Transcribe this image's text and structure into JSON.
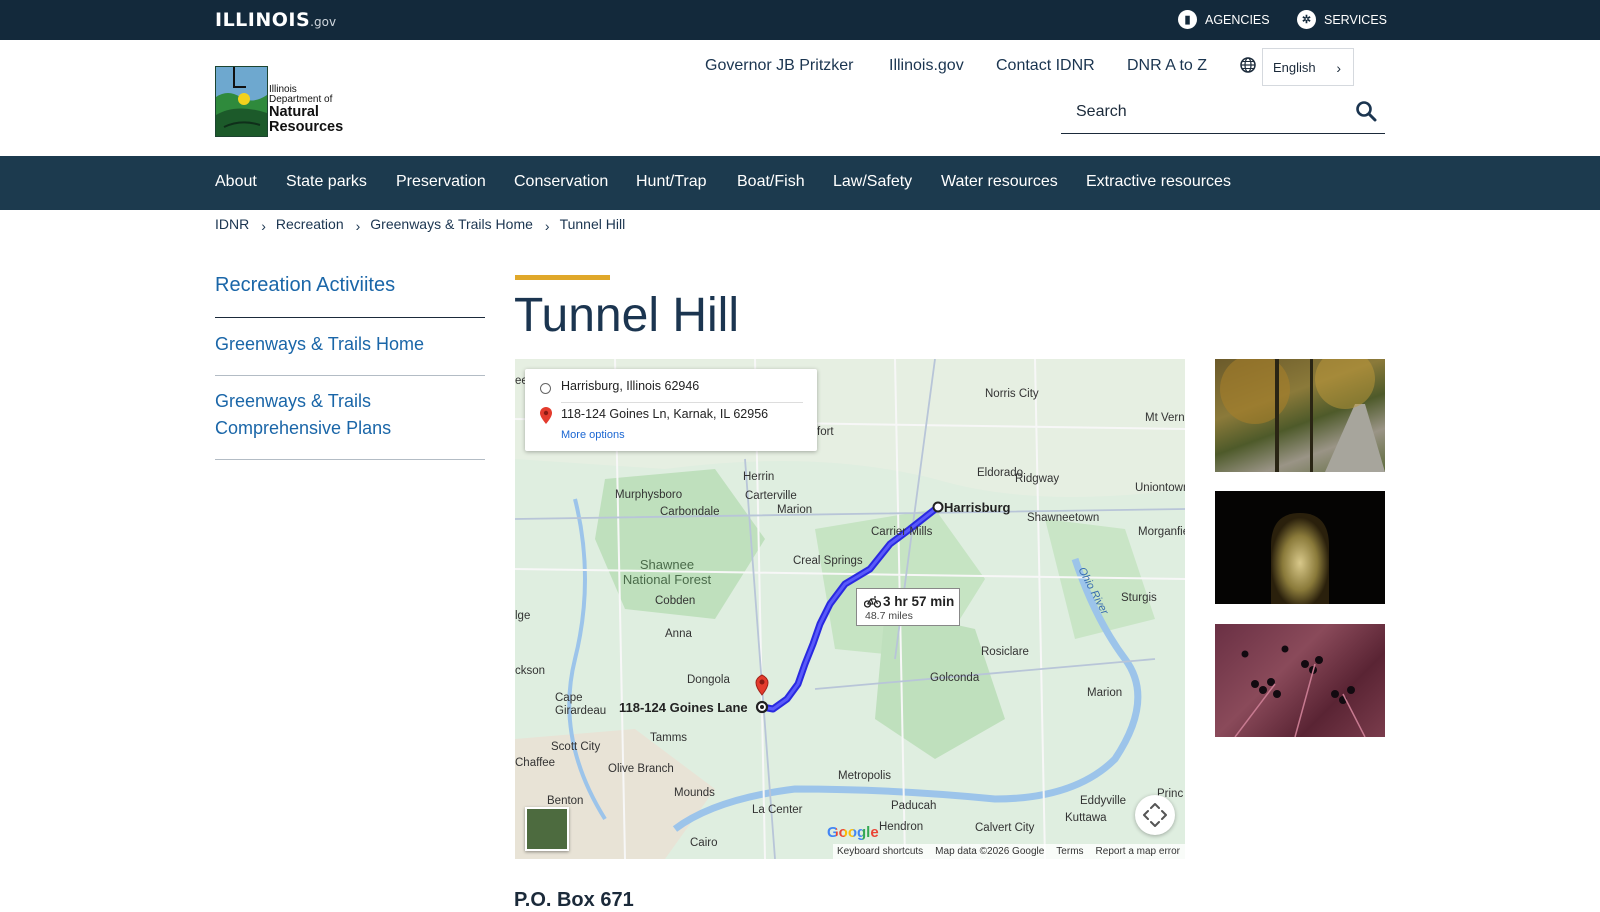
{
  "topbar": {
    "logo_main": "ILLINOIS",
    "logo_suffix": ".gov",
    "agencies": "AGENCIES",
    "services": "SERVICES"
  },
  "logo": {
    "line1": "Illinois",
    "line2": "Department of",
    "line3": "Natural",
    "line4": "Resources"
  },
  "utility_links": [
    "Governor JB Pritzker",
    "Illinois.gov",
    "Contact IDNR",
    "DNR A to Z"
  ],
  "language": {
    "selected": "English"
  },
  "search": {
    "placeholder": "Search"
  },
  "nav": [
    "About",
    "State parks",
    "Preservation",
    "Conservation",
    "Hunt/Trap",
    "Boat/Fish",
    "Law/Safety",
    "Water resources",
    "Extractive resources"
  ],
  "breadcrumbs": [
    "IDNR",
    "Recreation",
    "Greenways & Trails Home",
    "Tunnel Hill"
  ],
  "sidebar": {
    "heading": "Recreation Activiites",
    "items": [
      "Greenways & Trails Home",
      "Greenways & Trails Comprehensive Plans"
    ]
  },
  "page": {
    "title": "Tunnel Hill",
    "address_partial": "P.O. Box 671"
  },
  "map": {
    "origin": "Harrisburg, Illinois 62946",
    "destination": "118-124 Goines Ln, Karnak, IL 62956",
    "more_options": "More options",
    "duration": "3 hr 57 min",
    "distance": "48.7 miles",
    "origin_label": "Harrisburg",
    "dest_label": "118-124 Goines Lane",
    "google": "Google",
    "attribution": [
      "Keyboard shortcuts",
      "Map data ©2026 Google",
      "Terms",
      "Report a map error"
    ],
    "places": [
      "Norris City",
      "Eldorado",
      "Ridgway",
      "Shawneetown",
      "Herrin",
      "Carterville",
      "Murphysboro",
      "Carbondale",
      "Marion",
      "Carrier Mills",
      "Creal Springs",
      "Cobden",
      "Anna",
      "Dongola",
      "Cape Girardeau",
      "Tamms",
      "Scott City",
      "Olive Branch",
      "Mounds",
      "La Center",
      "Paducah",
      "Metropolis",
      "Golconda",
      "Rosiclare",
      "Sturgis",
      "Morganfie",
      "Uniontown",
      "Mt Vern",
      "Marion",
      "Calvert City",
      "Eddyville",
      "Kuttawa",
      "Benton",
      "Cairo",
      "Hendron",
      "Princ",
      "Chaffee",
      "ckson",
      "lge",
      "ee",
      "fort"
    ],
    "forest": "Shawnee National Forest",
    "river": "Ohio River"
  }
}
